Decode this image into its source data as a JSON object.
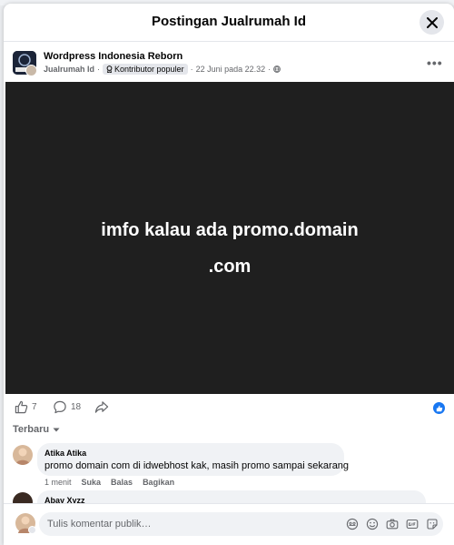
{
  "modal": {
    "title": "Postingan Jualrumah Id"
  },
  "post": {
    "group_name": "Wordpress Indonesia Reborn",
    "author": "Jualrumah Id",
    "badge": "Kontributor populer",
    "timestamp": "22 Juni pada 22.32",
    "text_line1": "imfo kalau ada promo.domain",
    "text_line2": ".com",
    "background_color": "#1f1f1f"
  },
  "actions": {
    "likes": "7",
    "comments": "18"
  },
  "comments": {
    "sort_label": "Terbaru",
    "items": [
      {
        "name": "Atika Atika",
        "text": "promo domain com di idwebhost kak, masih promo sampai sekarang",
        "time": "1 menit",
        "like": "Suka",
        "reply": "Balas",
        "share": "Bagikan"
      },
      {
        "name": "Abay Xyzz"
      }
    ]
  },
  "composer": {
    "placeholder": "Tulis komentar publik…"
  },
  "colors": {
    "accent": "#1877f2",
    "muted_text": "#65676b",
    "bubble": "#f0f2f5"
  }
}
